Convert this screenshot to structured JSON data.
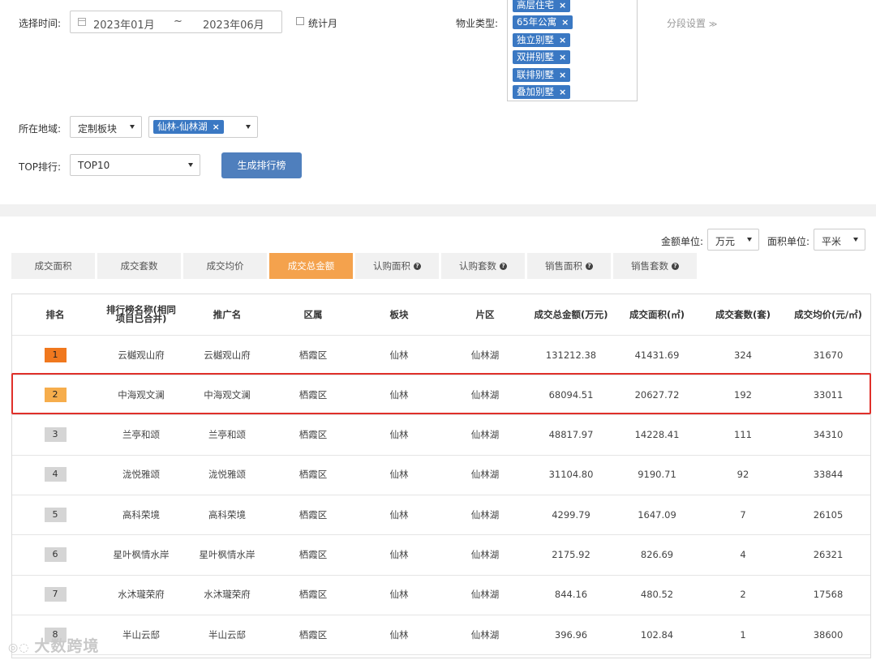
{
  "filters": {
    "time_label": "选择时间:",
    "date_start": "2023年01月",
    "date_sep": "~",
    "date_end": "2023年06月",
    "stat_month_label": "统计月",
    "property_type_label": "物业类型:",
    "property_tags": [
      "高层住宅",
      "65年公寓",
      "独立别墅",
      "双拼别墅",
      "联排别墅",
      "叠加别墅"
    ],
    "segment_label": "分段设置",
    "region_label": "所在地域:",
    "region_select": "定制板块",
    "region_tag": "仙林-仙林湖",
    "top_label": "TOP排行:",
    "top_select": "TOP10",
    "generate_button": "生成排行榜"
  },
  "units": {
    "amount_label": "金额单位:",
    "amount_value": "万元",
    "area_label": "面积单位:",
    "area_value": "平米"
  },
  "tabs": [
    {
      "label": "成交面积",
      "help": false,
      "active": false
    },
    {
      "label": "成交套数",
      "help": false,
      "active": false
    },
    {
      "label": "成交均价",
      "help": false,
      "active": false
    },
    {
      "label": "成交总金额",
      "help": false,
      "active": true
    },
    {
      "label": "认购面积",
      "help": true,
      "active": false
    },
    {
      "label": "认购套数",
      "help": true,
      "active": false
    },
    {
      "label": "销售面积",
      "help": true,
      "active": false
    },
    {
      "label": "销售套数",
      "help": true,
      "active": false
    }
  ],
  "table": {
    "headers": [
      "排名",
      "排行榜名称(相同项目已合并)",
      "推广名",
      "区属",
      "板块",
      "片区",
      "成交总金额(万元)",
      "成交面积(㎡)",
      "成交套数(套)",
      "成交均价(元/㎡)"
    ],
    "rows": [
      {
        "rank": "1",
        "name": "云樾观山府",
        "promo": "云樾观山府",
        "district": "栖霞区",
        "block": "仙林",
        "area": "仙林湖",
        "amount": "131212.38",
        "size": "41431.69",
        "units": "324",
        "avg": "31670"
      },
      {
        "rank": "2",
        "name": "中海观文澜",
        "promo": "中海观文澜",
        "district": "栖霞区",
        "block": "仙林",
        "area": "仙林湖",
        "amount": "68094.51",
        "size": "20627.72",
        "units": "192",
        "avg": "33011"
      },
      {
        "rank": "3",
        "name": "兰亭和颂",
        "promo": "兰亭和颂",
        "district": "栖霞区",
        "block": "仙林",
        "area": "仙林湖",
        "amount": "48817.97",
        "size": "14228.41",
        "units": "111",
        "avg": "34310"
      },
      {
        "rank": "4",
        "name": "泷悦雅颂",
        "promo": "泷悦雅颂",
        "district": "栖霞区",
        "block": "仙林",
        "area": "仙林湖",
        "amount": "31104.80",
        "size": "9190.71",
        "units": "92",
        "avg": "33844"
      },
      {
        "rank": "5",
        "name": "高科荣境",
        "promo": "高科荣境",
        "district": "栖霞区",
        "block": "仙林",
        "area": "仙林湖",
        "amount": "4299.79",
        "size": "1647.09",
        "units": "7",
        "avg": "26105"
      },
      {
        "rank": "6",
        "name": "星叶枫情水岸",
        "promo": "星叶枫情水岸",
        "district": "栖霞区",
        "block": "仙林",
        "area": "仙林湖",
        "amount": "2175.92",
        "size": "826.69",
        "units": "4",
        "avg": "26321"
      },
      {
        "rank": "7",
        "name": "水沐瓏荣府",
        "promo": "水沐瓏荣府",
        "district": "栖霞区",
        "block": "仙林",
        "area": "仙林湖",
        "amount": "844.16",
        "size": "480.52",
        "units": "2",
        "avg": "17568"
      },
      {
        "rank": "8",
        "name": "半山云邸",
        "promo": "半山云邸",
        "district": "栖霞区",
        "block": "仙林",
        "area": "仙林湖",
        "amount": "396.96",
        "size": "102.84",
        "units": "1",
        "avg": "38600"
      }
    ]
  },
  "watermark": "大数跨境",
  "colors": {
    "accent": "#f4a24d",
    "primary": "#4f7fbd",
    "tag": "#3a78c3",
    "rank1": "#f0781e",
    "rank2": "#f6ad4c",
    "highlight": "#e0302a"
  }
}
